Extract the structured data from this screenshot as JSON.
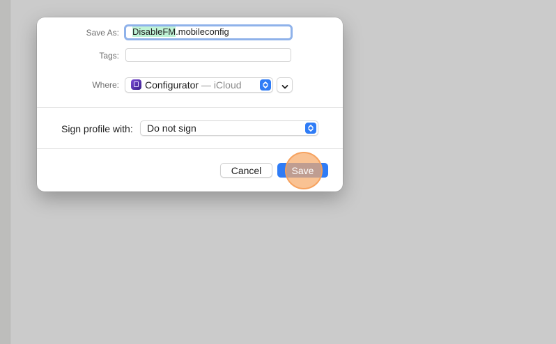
{
  "dialog": {
    "save_as_label": "Save As:",
    "filename_selected": "DisableFM",
    "filename_ext": ".mobileconfig",
    "tags_label": "Tags:",
    "tags_value": "",
    "where_label": "Where:",
    "where_location": "Configurator",
    "where_suffix": " — iCloud",
    "sign_label": "Sign profile with:",
    "sign_value": "Do not sign",
    "cancel_label": "Cancel",
    "save_label": "Save"
  },
  "colors": {
    "accent": "#2f7cf6",
    "selection_highlight": "#bff3d6",
    "click_indicator": "#f6aa69"
  },
  "icons": [
    "configurator-app-icon",
    "stepper-icon",
    "chevron-down-icon"
  ]
}
